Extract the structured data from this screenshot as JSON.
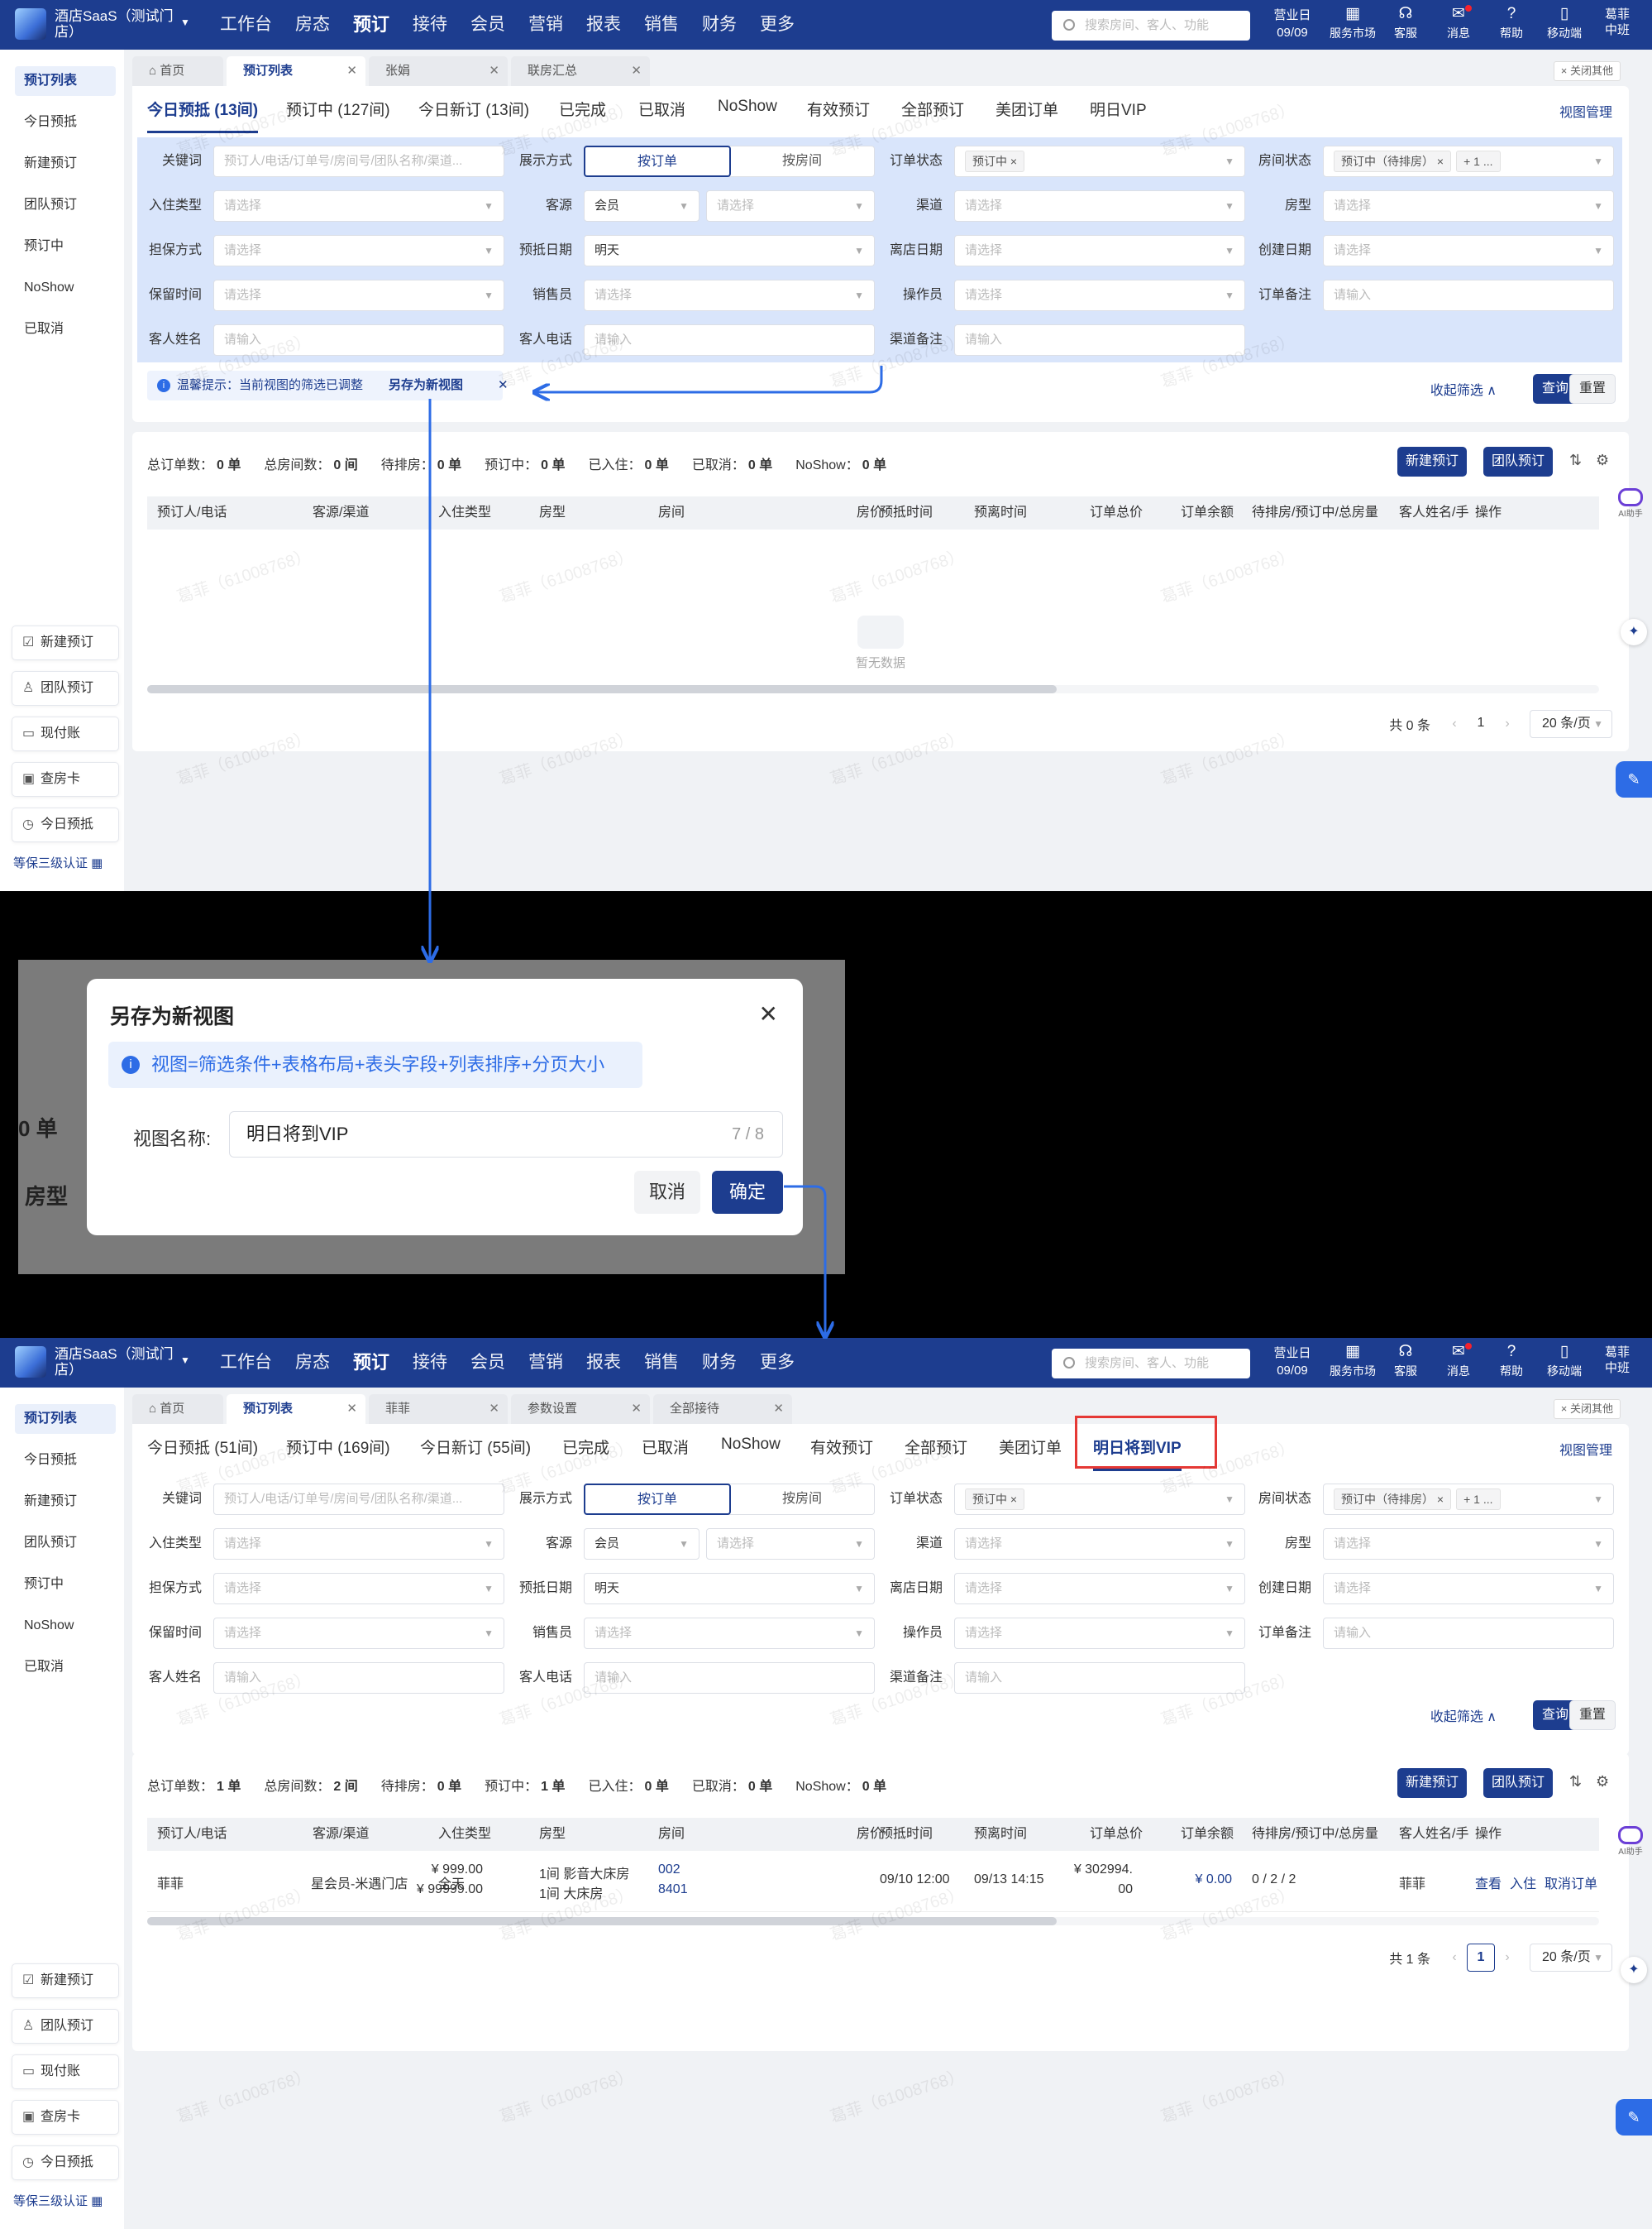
{
  "app": {
    "brand": "酒店SaaS（测试门店）",
    "nav": [
      "工作台",
      "房态",
      "预订",
      "接待",
      "会员",
      "营销",
      "报表",
      "销售",
      "财务",
      "更多"
    ],
    "nav_active": "预订",
    "search_placeholder": "搜索房间、客人、功能",
    "bizday_label": "营业日",
    "bizday": "09/09",
    "icons": [
      {
        "label": "服务市场",
        "icon": "grid-icon"
      },
      {
        "label": "客服",
        "icon": "headset-icon"
      },
      {
        "label": "消息",
        "icon": "mail-icon"
      },
      {
        "label": "帮助",
        "icon": "help-icon"
      },
      {
        "label": "移动端",
        "icon": "phone-icon"
      },
      {
        "label": "葛菲 中班",
        "icon": "user-icon"
      }
    ]
  },
  "sidebar": {
    "items": [
      "预订列表",
      "今日预抵",
      "新建预订",
      "团队预订",
      "预订中",
      "NoShow",
      "已取消"
    ],
    "quick": [
      "新建预订",
      "团队预订",
      "现付账",
      "查房卡",
      "今日预抵"
    ],
    "cert": "等保三级认证"
  },
  "shot1": {
    "tabs": [
      "首页",
      "预订列表",
      "张娟",
      "联房汇总"
    ],
    "view_tabs": [
      "今日预抵 (13间)",
      "预订中 (127间)",
      "今日新订 (13间)",
      "已完成",
      "已取消",
      "NoShow",
      "有效预订",
      "全部预订",
      "美团订单",
      "明日VIP"
    ],
    "hint": {
      "text": "温馨提示：当前视图的筛选已调整",
      "action": "另存为新视图"
    },
    "stats": [
      {
        "label": "总订单数：",
        "value": "0 单"
      },
      {
        "label": "总房间数：",
        "value": "0 间"
      },
      {
        "label": "待排房：",
        "value": "0 单"
      },
      {
        "label": "预订中：",
        "value": "0 单"
      },
      {
        "label": "已入住：",
        "value": "0 单"
      },
      {
        "label": "已取消：",
        "value": "0 单"
      },
      {
        "label": "NoShow：",
        "value": "0 单"
      }
    ],
    "empty": "暂无数据",
    "total": "共 0 条",
    "page": "1"
  },
  "shot2": {
    "tabs": [
      "首页",
      "预订列表",
      "菲菲",
      "参数设置",
      "全部接待"
    ],
    "view_tabs": [
      "今日预抵 (51间)",
      "预订中 (169间)",
      "今日新订 (55间)",
      "已完成",
      "已取消",
      "NoShow",
      "有效预订",
      "全部预订",
      "美团订单",
      "明日将到VIP"
    ],
    "stats": [
      {
        "label": "总订单数：",
        "value": "1 单"
      },
      {
        "label": "总房间数：",
        "value": "2 间"
      },
      {
        "label": "待排房：",
        "value": "0 单"
      },
      {
        "label": "预订中：",
        "value": "1 单"
      },
      {
        "label": "已入住：",
        "value": "0 单"
      },
      {
        "label": "已取消：",
        "value": "0 单"
      },
      {
        "label": "NoShow：",
        "value": "0 单"
      }
    ],
    "row": {
      "guest": "菲菲",
      "source": "星会员-米遇门店",
      "checkin_type": "全天",
      "roomtype1": "1间 影音大床房",
      "roomtype2": "1间 大床房",
      "room1": "002",
      "room2": "8401",
      "price1": "¥ 999.00",
      "price2": "¥ 99999.00",
      "arrive": "09/10 12:00",
      "depart": "09/13 14:15",
      "total1": "¥ 302994.",
      "total2": "00",
      "balance": "¥ 0.00",
      "rooms": "0 / 2 / 2",
      "name": "菲菲",
      "ops": [
        "查看",
        "入住",
        "取消订单"
      ]
    },
    "total": "共 1 条",
    "page": "1"
  },
  "close_others": "× 关闭其他",
  "view_manage": "视图管理",
  "filters": {
    "keyword_label": "关键词",
    "keyword_ph": "预订人/电话/订单号/房间号/团队名称/渠道...",
    "display_label": "展示方式",
    "display_opts": [
      "按订单",
      "按房间"
    ],
    "status_label": "订单状态",
    "status_chip": "预订中 ×",
    "room_status_label": "房间状态",
    "room_status_chip": "预订中（待排房） ×",
    "room_status_more": "+ 1 ...",
    "checkin_type_label": "入住类型",
    "source_label": "客源",
    "source_value": "会员",
    "channel_label": "渠道",
    "roomtype_label": "房型",
    "guarantee_label": "担保方式",
    "arrive_label": "预抵日期",
    "arrive_value": "明天",
    "depart_label": "离店日期",
    "create_label": "创建日期",
    "hold_label": "保留时间",
    "sales_label": "销售员",
    "operator_label": "操作员",
    "remark_label": "订单备注",
    "name_label": "客人姓名",
    "phone_label": "客人电话",
    "channel_remark_label": "渠道备注",
    "select_ph": "请选择",
    "input_ph": "请输入"
  },
  "actions": {
    "collapse": "收起筛选 ∧",
    "query": "查询",
    "reset": "重置",
    "new": "新建预订",
    "group": "团队预订"
  },
  "table_headers": [
    "预订人/电话",
    "客源/渠道",
    "入住类型",
    "房型",
    "房间",
    "房价",
    "预抵时间",
    "预离时间",
    "订单总价",
    "订单余额",
    "待排房/预订中/总房量",
    "客人姓名/手",
    "操作"
  ],
  "pager_size": "20 条/页",
  "ai_label": "AI助手",
  "watermark": "葛菲（61008768）",
  "dialog": {
    "title": "另存为新视图",
    "alert": "视图=筛选条件+表格布局+表头字段+列表排序+分页大小",
    "name_label": "视图名称:",
    "name_value": "明日将到VIP",
    "count": "7 / 8",
    "cancel": "取消",
    "ok": "确定",
    "bg_text": [
      "0 单",
      "房型"
    ]
  }
}
